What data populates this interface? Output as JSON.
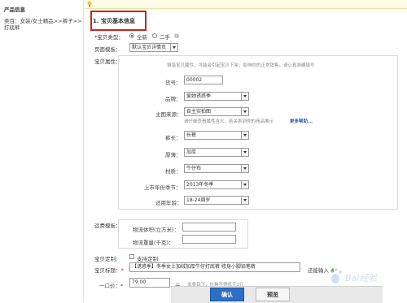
{
  "left": {
    "heading": "产品信息",
    "category_line1": "类目：女装/女士精品>>裤子>>",
    "category_line2": "打底裤"
  },
  "section": {
    "title": "1. 宝贝基本信息"
  },
  "item_type": {
    "label": "宝贝类型：",
    "options": [
      "全新",
      "二手"
    ],
    "selected": "全新"
  },
  "page_template": {
    "label": "页面模板：",
    "value": "默认宝贝详情页"
  },
  "attributes": {
    "label": "宝贝属性：",
    "hint": "填错宝贝属性，可能会引起宝贝下架，影响你的正常销售。请认真准确填写",
    "item_no": {
      "label": "货号：",
      "value": "00002"
    },
    "brand": {
      "label": "品牌：",
      "value": "爱她诱惑季"
    },
    "brand_source": {
      "label": "主图来源：",
      "value": "自主实拍图"
    },
    "brand_source_hint": "请仔细查看属性含义，若关系到你的商品展示",
    "more_help": "更多帮助...",
    "pants_length": {
      "label": "裤长：",
      "value": "长裤"
    },
    "thickness": {
      "label": "厚薄：",
      "value": "加厚"
    },
    "material": {
      "label": "材质：",
      "value": "牛仔布"
    },
    "season": {
      "label": "上市年份季节：",
      "value": "2013年冬季"
    },
    "age": {
      "label": "适用年龄：",
      "value": "18-24周岁"
    }
  },
  "shipping": {
    "label": "运费模板：",
    "volume_label": "物流体积(立方米)：",
    "weight_label": "物流重量(千克)：",
    "volume_value": "",
    "weight_value": ""
  },
  "customize": {
    "label": "宝贝定制：",
    "checkbox_label": "支持定制"
  },
  "title_field": {
    "label": "宝贝标题：",
    "value": "【诱惑季】冬季女士加绒加厚牛仔打底裤 修身小脚铅笔裤",
    "counter_prefix": "还能输入",
    "counter_value": "4"
  },
  "price": {
    "label": "一口价：",
    "value": "79.00",
    "unit": "元",
    "hint": "本类目下，价格不得低于2元"
  },
  "buttons": {
    "confirm": "确认",
    "preview": "预览"
  },
  "watermark_text": "Bai经验",
  "colors": {
    "highlight_border": "#c0281d",
    "primary_button": "#2d6fc4",
    "link": "#2a5db0"
  }
}
